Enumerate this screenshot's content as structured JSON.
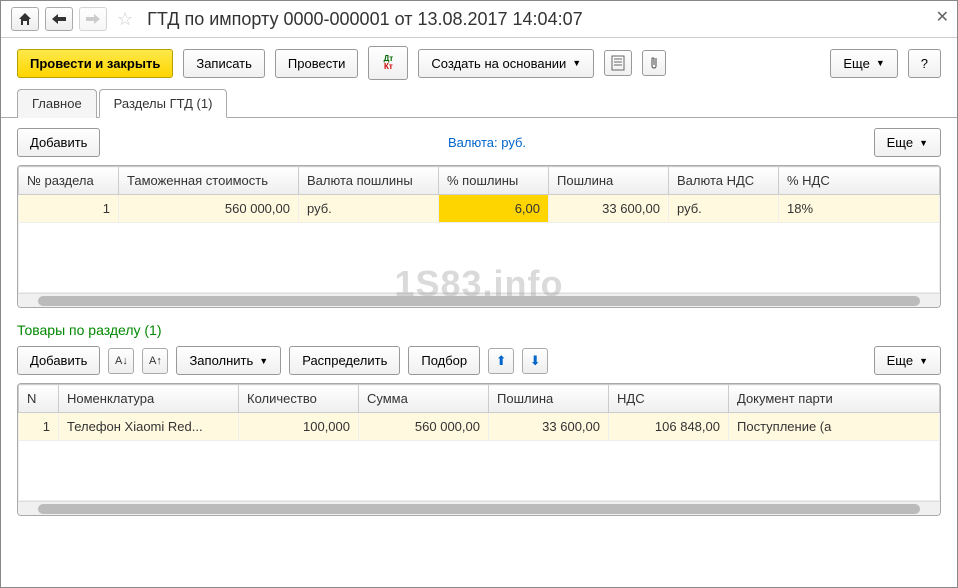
{
  "title": "ГТД по импорту 0000-000001 от 13.08.2017 14:04:07",
  "watermark": "1S83.info",
  "toolbar": {
    "postAndClose": "Провести и закрыть",
    "write": "Записать",
    "post": "Провести",
    "createBasedOn": "Создать на основании",
    "more": "Еще",
    "help": "?"
  },
  "tabs": {
    "main": "Главное",
    "sections": "Разделы ГТД (1)"
  },
  "topBar": {
    "add": "Добавить",
    "currencyLabel": "Валюта:",
    "currencyValue": "руб.",
    "more": "Еще"
  },
  "table1": {
    "headers": {
      "num": "№ раздела",
      "customsValue": "Таможенная стоимость",
      "dutyCurrency": "Валюта пошлины",
      "dutyPercent": "% пошлины",
      "duty": "Пошлина",
      "vatCurrency": "Валюта НДС",
      "vatPercent": "% НДС"
    },
    "rows": [
      {
        "num": "1",
        "customsValue": "560 000,00",
        "dutyCurrency": "руб.",
        "dutyPercent": "6,00",
        "duty": "33 600,00",
        "vatCurrency": "руб.",
        "vatPercent": "18%"
      }
    ]
  },
  "sectionGoods": {
    "title": "Товары по разделу (1)",
    "add": "Добавить",
    "fill": "Заполнить",
    "distribute": "Распределить",
    "selection": "Подбор",
    "more": "Еще"
  },
  "table2": {
    "headers": {
      "n": "N",
      "item": "Номенклатура",
      "qty": "Количество",
      "sum": "Сумма",
      "duty": "Пошлина",
      "vat": "НДС",
      "docBatch": "Документ парти"
    },
    "rows": [
      {
        "n": "1",
        "item": "Телефон Xiaomi Red...",
        "qty": "100,000",
        "sum": "560 000,00",
        "duty": "33 600,00",
        "vat": "106 848,00",
        "docBatch": "Поступление (а"
      }
    ]
  }
}
